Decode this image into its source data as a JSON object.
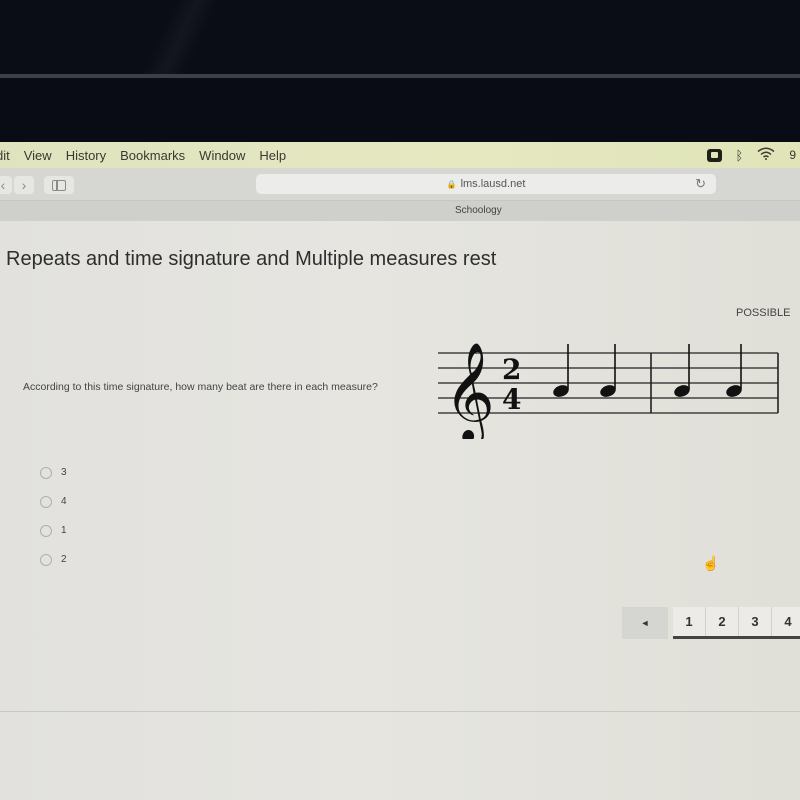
{
  "menubar": {
    "items": [
      "dit",
      "View",
      "History",
      "Bookmarks",
      "Window",
      "Help"
    ],
    "clock": "9"
  },
  "browser": {
    "url": "lms.lausd.net",
    "tab_title": "Schoology"
  },
  "page": {
    "title": "Repeats and time signature and Multiple measures rest",
    "possible_label": "POSSIBLE",
    "question": "According to this time signature, how many beat are there in each measure?",
    "time_signature": {
      "top": "2",
      "bottom": "4"
    },
    "options": [
      "3",
      "4",
      "1",
      "2"
    ],
    "selected_option": null
  },
  "pager": {
    "prev_label": "◄",
    "pages": [
      "1",
      "2",
      "3",
      "4"
    ],
    "current_page": "1"
  }
}
